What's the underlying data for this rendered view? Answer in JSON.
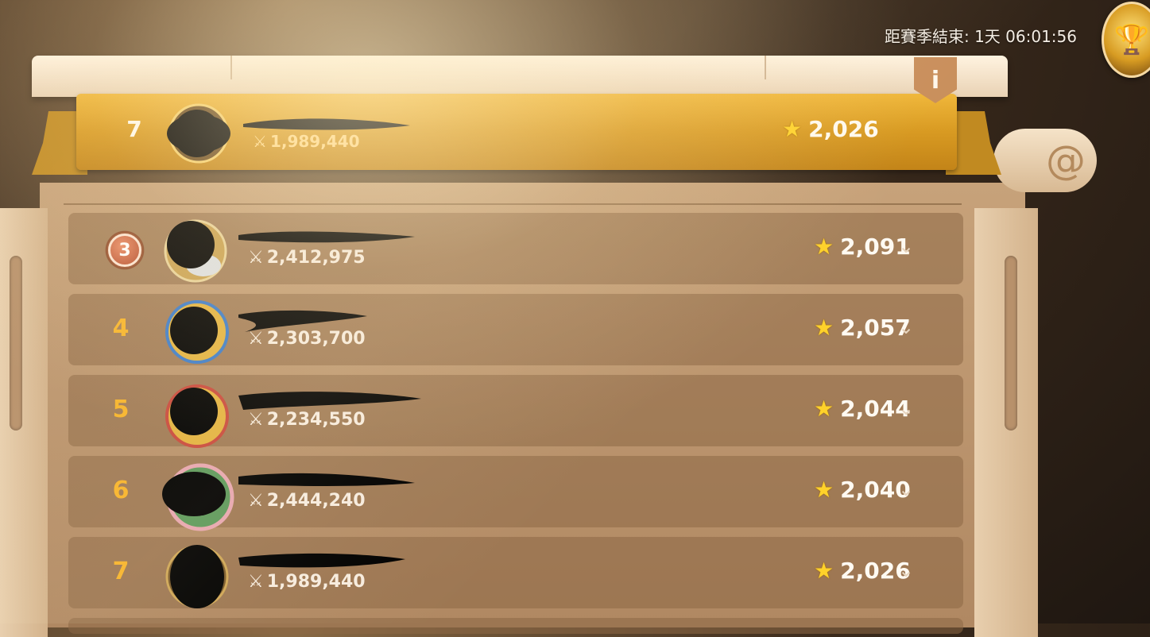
{
  "header": {
    "season_timer_label": "距賽季結束: 1天 06:01:56",
    "trophy_icon": "trophy-icon"
  },
  "info_label": "i",
  "my_rank": {
    "rank": "7",
    "power": "1,989,440",
    "score": "2,026"
  },
  "leaderboard": [
    {
      "rank": "3",
      "medal": true,
      "power": "2,412,975",
      "score": "2,091"
    },
    {
      "rank": "4",
      "medal": false,
      "power": "2,303,700",
      "score": "2,057"
    },
    {
      "rank": "5",
      "medal": false,
      "power": "2,234,550",
      "score": "2,044"
    },
    {
      "rank": "6",
      "medal": false,
      "power": "2,444,240",
      "score": "2,040"
    },
    {
      "rank": "7",
      "medal": false,
      "power": "1,989,440",
      "score": "2,026"
    }
  ],
  "colors": {
    "gold_banner": "#d89a22",
    "rank_text": "#f7b42b",
    "star": "#ffd22a"
  }
}
